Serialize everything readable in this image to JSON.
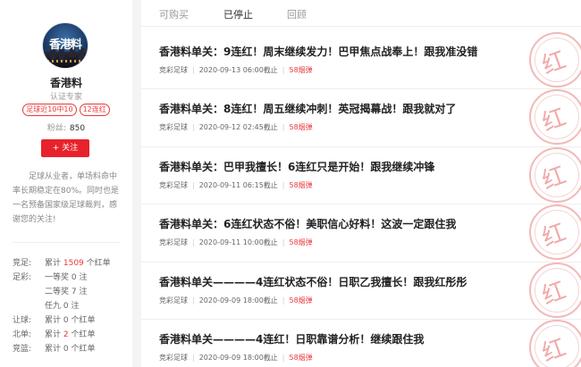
{
  "profile": {
    "avatar_text": "香港料",
    "name": "香港料",
    "verified": "认证专家",
    "badges": [
      "足球近10中10",
      "12连红"
    ],
    "fans_label": "粉丝:",
    "fans_count": "850",
    "follow_label": "+ 关注",
    "bio": "足球从业者，单场料命中率长期稳定在80%。同时也是一名预备国家级足球裁判，感谢您的关注!"
  },
  "stats": [
    {
      "label": "竞足:",
      "pre": "累计 ",
      "num": "1509",
      "post": " 个红单"
    },
    {
      "label": "足彩:",
      "pre": "一等奖 ",
      "num": "0",
      "post": " 注"
    },
    {
      "label": "",
      "pre": "二等奖 ",
      "num": "7",
      "post": " 注"
    },
    {
      "label": "",
      "pre": "任九 ",
      "num": "0",
      "post": " 注"
    },
    {
      "label": "让球:",
      "pre": "累计 ",
      "num": "0",
      "post": " 个红单"
    },
    {
      "label": "北单:",
      "pre": "累计 ",
      "num": "2",
      "post": " 个红单"
    },
    {
      "label": "竞篮:",
      "pre": "累计 ",
      "num": "0",
      "post": " 个红单"
    }
  ],
  "tabs": [
    "可购买",
    "已停止",
    "回顾"
  ],
  "active_tab": 1,
  "articles": [
    {
      "title": "香港料单关：9连红！周末继续发力！巴甲焦点战奉上！跟我准没错",
      "category": "竞彩足球",
      "date": "2020-09-13 06:00截止",
      "price": "58烟弹"
    },
    {
      "title": "香港料单关：8连红！周五继续冲刺！英冠揭幕战！跟我就对了",
      "category": "竞彩足球",
      "date": "2020-09-12 02:45截止",
      "price": "58烟弹"
    },
    {
      "title": "香港料单关：巴甲我擅长！6连红只是开始！跟我继续冲锋",
      "category": "竞彩足球",
      "date": "2020-09-11 06:15截止",
      "price": "58烟弹"
    },
    {
      "title": "香港料单关：6连红状态不俗！美职信心好料！这波一定跟住我",
      "category": "竞彩足球",
      "date": "2020-09-11 10:00截止",
      "price": "58烟弹"
    },
    {
      "title": "香港料单关————4连红状态不俗！日职乙我擅长！跟我红彤彤",
      "category": "竞彩足球",
      "date": "2020-09-09 18:00截止",
      "price": "58烟弹"
    },
    {
      "title": "香港料单关————4连红！日职靠谱分析！继续跟住我",
      "category": "竞彩足球",
      "date": "2020-09-09 18:00截止",
      "price": "58烟弹"
    }
  ],
  "stamp_text": "红",
  "colors": {
    "accent": "#e8222b",
    "stamp": "#f2a8a8"
  }
}
